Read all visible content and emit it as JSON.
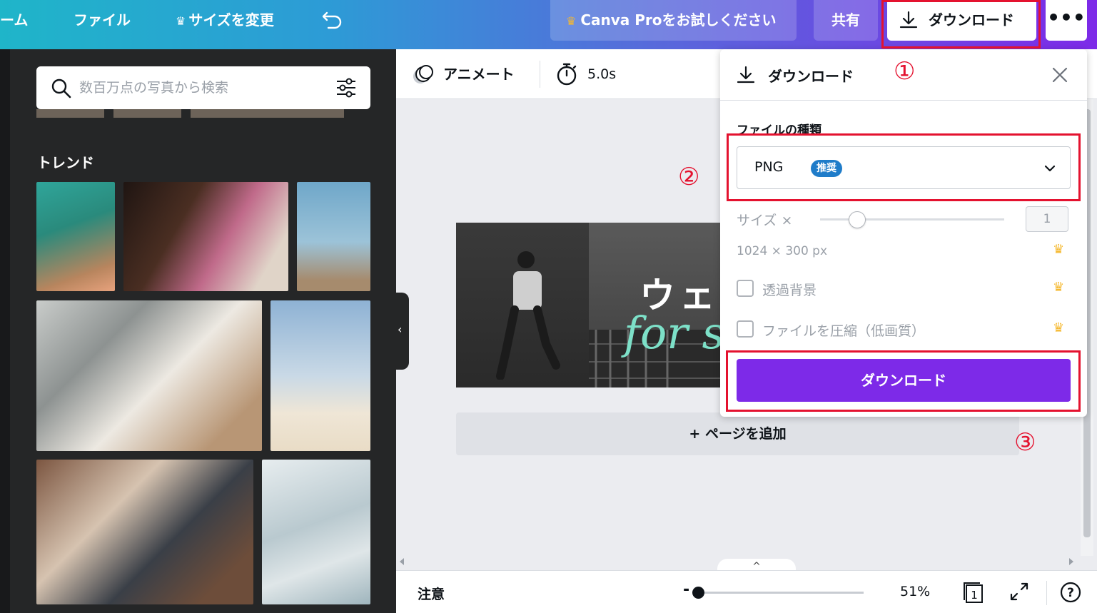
{
  "topbar": {
    "home_label": "ーム",
    "file_label": "ファイル",
    "resize_label": "サイズを変更",
    "pro_label": "Canva Proをお試しください",
    "share_label": "共有",
    "download_label": "ダウンロード",
    "more_label": "•••",
    "crown_icon": "crown-icon",
    "undo_icon": "undo-icon"
  },
  "annotations": {
    "mark1": "①",
    "mark2": "②",
    "mark3": "③",
    "color": "#e4122f"
  },
  "sidebar": {
    "search_placeholder": "数百万点の写真から検索",
    "section_title": "トレンド"
  },
  "toolbar": {
    "animate_label": "アニメート",
    "duration": "5.0s"
  },
  "canvas": {
    "title_text": "ウェ",
    "script_text": "for s",
    "add_page_label": "+ ページを追加"
  },
  "bottombar": {
    "notes_label": "注意",
    "zoom": "51%",
    "zoom_fraction": 0.05,
    "page_count": "1",
    "tab_arrow": "^"
  },
  "download_panel": {
    "title": "ダウンロード",
    "file_type_label": "ファイルの種類",
    "file_type_value": "PNG",
    "recommended_badge": "推奨",
    "size_label": "サイズ ×",
    "size_value": "1",
    "dimensions": "1024 × 300 px",
    "transparent_bg_label": "透過背景",
    "compress_label": "ファイルを圧縮（低画質）",
    "download_button": "ダウンロード"
  },
  "colors": {
    "accent_purple": "#7d2ae8",
    "badge_blue": "#1f7cc9",
    "crown_gold": "#f5b82e",
    "annotation_red": "#e4122f"
  }
}
